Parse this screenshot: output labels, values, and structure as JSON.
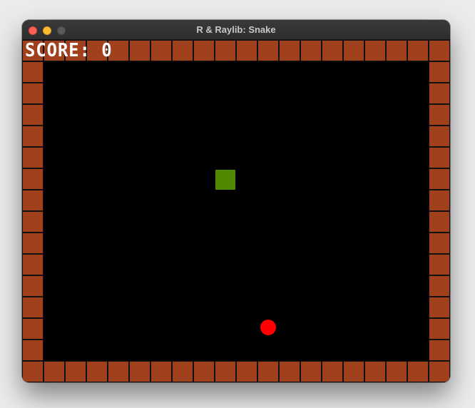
{
  "window": {
    "title": "R & Raylib: Snake",
    "controls": {
      "close_color": "#fe5f57",
      "minimize_color": "#febc2e",
      "maximize_color": "#5a5a5a"
    }
  },
  "game": {
    "score_text": "SCORE: 0",
    "grid": {
      "columns": 20,
      "rows": 16
    },
    "wall_color": "#a0401c",
    "background_color": "#000000",
    "snake": {
      "color": "#4f8a00",
      "head": {
        "col": 9,
        "row": 6
      }
    },
    "food": {
      "color": "#ff0000",
      "col": 11,
      "row": 13
    }
  }
}
